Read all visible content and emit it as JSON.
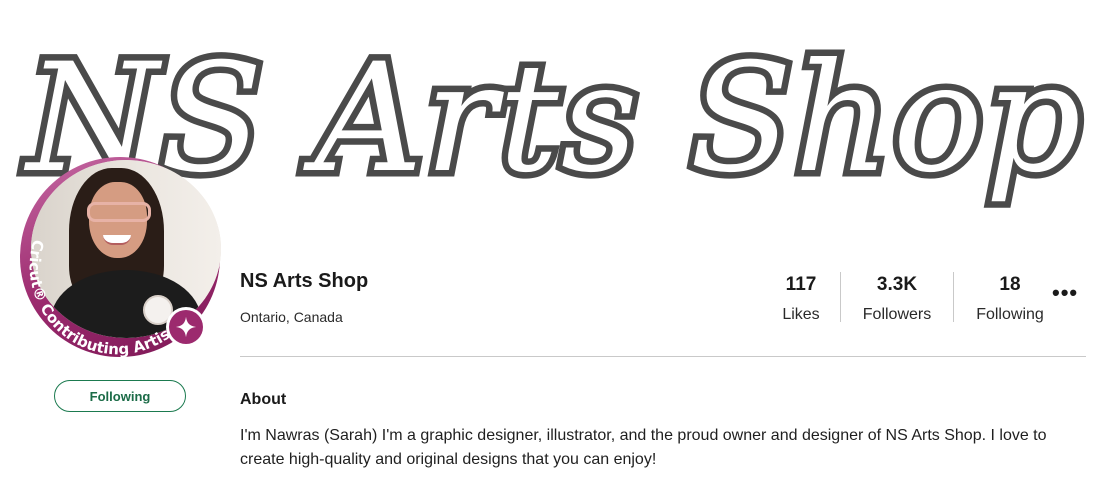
{
  "banner": {
    "title": "NS Arts Shop"
  },
  "avatar": {
    "ring_text": "Cricut® Contributing Artist",
    "badge_icon": "sparkle-icon"
  },
  "profile": {
    "name": "NS Arts Shop",
    "location": "Ontario, Canada",
    "follow_button": "Following"
  },
  "stats": [
    {
      "value": "117",
      "label": "Likes"
    },
    {
      "value": "3.3K",
      "label": "Followers"
    },
    {
      "value": "18",
      "label": "Following"
    }
  ],
  "more_menu": {
    "label": "•••",
    "icon": "more-dots-icon"
  },
  "about": {
    "heading": "About",
    "text": "I'm Nawras (Sarah) I'm a graphic designer, illustrator, and the proud owner and designer of NS Arts Shop. I love to create high-quality and original designs that you can enjoy!"
  },
  "colors": {
    "accent": "#9c2a6e",
    "follow_border": "#1b7a4f",
    "divider": "#c9c9c9"
  }
}
